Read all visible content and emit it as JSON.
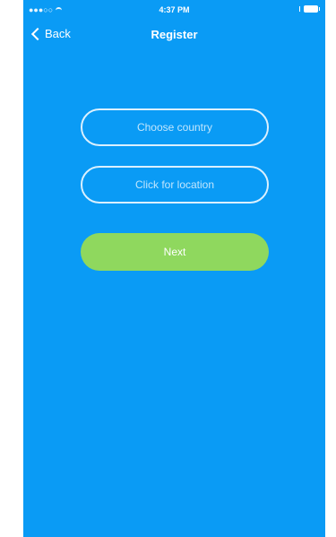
{
  "status_bar": {
    "carrier": "●●●○○ ",
    "time": "4:37 PM"
  },
  "nav": {
    "back_label": "Back",
    "title": "Register"
  },
  "form": {
    "country_placeholder": "Choose country",
    "location_placeholder": "Click for location",
    "next_label": "Next"
  },
  "colors": {
    "background": "#0a9bf5",
    "next_button": "#8fd85e",
    "text": "#ffffff"
  }
}
